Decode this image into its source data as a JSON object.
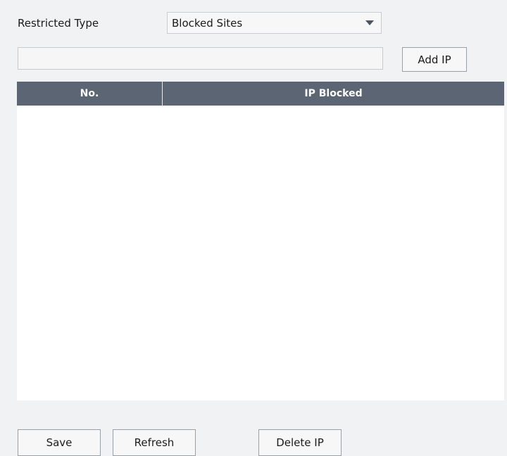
{
  "restricted": {
    "label": "Restricted Type",
    "selected": "Blocked Sites"
  },
  "ip_input": {
    "value": "",
    "placeholder": ""
  },
  "buttons": {
    "add_ip": "Add IP",
    "save": "Save",
    "refresh": "Refresh",
    "delete_ip": "Delete IP"
  },
  "table": {
    "columns": [
      "No.",
      "IP Blocked"
    ],
    "rows": []
  },
  "colors": {
    "header_bg": "#5b6574",
    "page_bg": "#f1f2f4"
  }
}
